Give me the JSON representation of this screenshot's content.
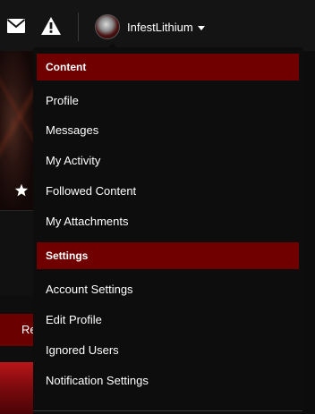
{
  "topbar": {
    "envelope_icon": "envelope-icon",
    "alert_icon": "warning-icon",
    "user": {
      "username": "InfestLithium",
      "caret_icon": "caret-down-icon"
    }
  },
  "background": {
    "star_icon": "star-icon",
    "button_label": "Re"
  },
  "dropdown": {
    "sections": [
      {
        "header": "Content",
        "items": [
          "Profile",
          "Messages",
          "My Activity",
          "Followed Content",
          "My Attachments"
        ]
      },
      {
        "header": "Settings",
        "items": [
          "Account Settings",
          "Edit Profile",
          "Ignored Users",
          "Notification Settings"
        ]
      }
    ]
  },
  "colors": {
    "accent": "#700000",
    "background": "#0d0d0d",
    "text": "#ffffff"
  }
}
